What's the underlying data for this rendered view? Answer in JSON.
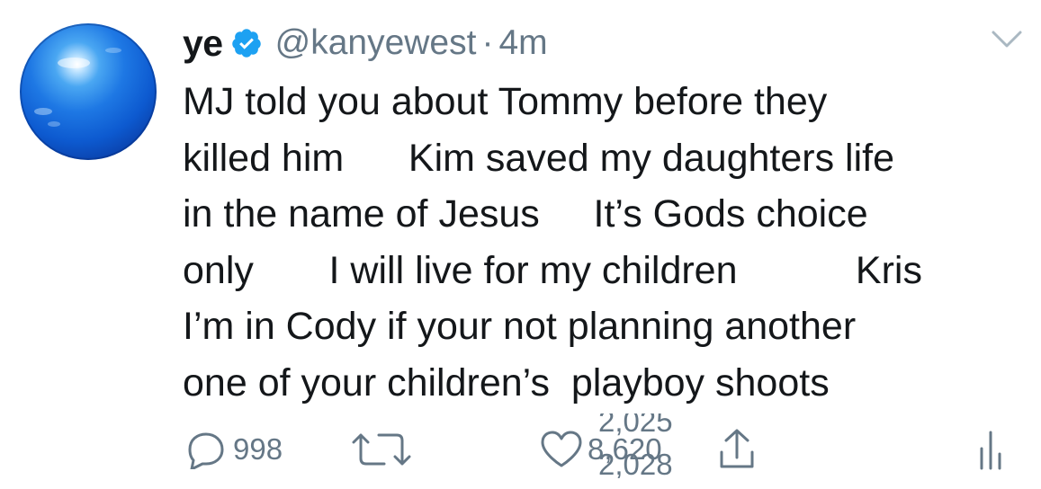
{
  "tweet": {
    "author_name": "ye",
    "verified": true,
    "handle": "@kanyewest",
    "separator": "·",
    "time": "4m",
    "text_lines": [
      "MJ told you about Tommy before they",
      "killed him      Kim saved my daughters life",
      "in the name of Jesus     It’s Gods choice",
      "only       I will live for my children           Kris",
      "I’m in Cody if your not planning another",
      "one of your children’s  playboy shoots"
    ]
  },
  "actions": {
    "replies": "998",
    "retweets_previous": "2,025",
    "retweets_current": "2,028",
    "likes": "8,620"
  },
  "icons": {
    "avatar": "blue-globe-avatar",
    "verified": "verified-badge-icon",
    "menu": "chevron-down-icon",
    "reply": "reply-icon",
    "retweet": "retweet-icon",
    "like": "heart-icon",
    "share": "share-icon",
    "analytics": "analytics-icon"
  },
  "colors": {
    "text": "#14171a",
    "secondary": "#657786",
    "verified": "#1da1f2",
    "avatar": "#1e78e4"
  }
}
